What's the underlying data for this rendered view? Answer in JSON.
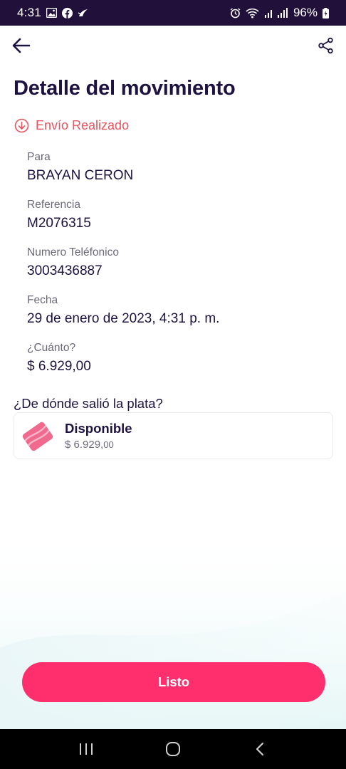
{
  "status_bar": {
    "time": "4:31",
    "battery": "96%",
    "left_icons": [
      "gallery-icon",
      "facebook-icon",
      "app-notification-icon"
    ],
    "right_icons": [
      "alarm-icon",
      "wifi-icon",
      "signal-icon",
      "battery-icon"
    ]
  },
  "app_bar": {
    "back_icon": "arrow-left-icon",
    "share_icon": "share-icon"
  },
  "page": {
    "title": "Detalle del movimiento",
    "status": "Envío Realizado",
    "status_color": "#e8555f"
  },
  "fields": [
    {
      "label": "Para",
      "value": "BRAYAN CERON"
    },
    {
      "label": "Referencia",
      "value": "M2076315"
    },
    {
      "label": "Numero Teléfonico",
      "value": "3003436887"
    },
    {
      "label": "Fecha",
      "value": "29 de enero de 2023, 4:31 p. m."
    },
    {
      "label": "¿Cuánto?",
      "value": "$ 6.929,00"
    }
  ],
  "source": {
    "question": "¿De dónde salió la plata?",
    "card": {
      "title": "Disponible",
      "amount_main": "$ 6.929,",
      "amount_cents": "00"
    }
  },
  "action": {
    "done_label": "Listo",
    "color": "#ff2f6d"
  },
  "nav_bar": {
    "icons": [
      "recent-apps-icon",
      "home-icon",
      "back-icon"
    ]
  },
  "colors": {
    "primary_text": "#1e1240",
    "secondary_text": "#6c6878",
    "status_bar": "#20103a"
  }
}
